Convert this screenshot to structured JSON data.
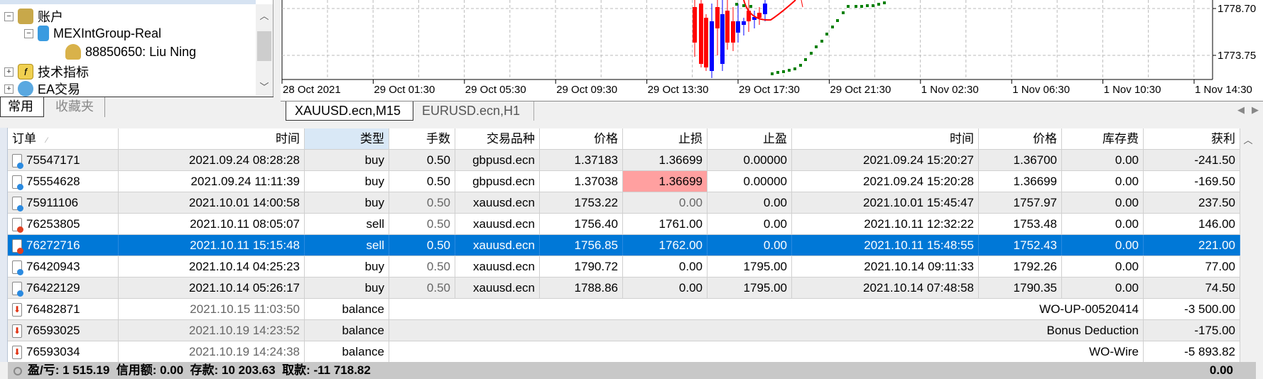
{
  "navigator": {
    "items": [
      {
        "label": "账户",
        "expander": "−",
        "icon": "accounts-icon"
      },
      {
        "label": "MEXIntGroup-Real",
        "expander": "−",
        "icon": "server-icon"
      },
      {
        "label": "88850650: Liu Ning",
        "icon": "user-icon"
      },
      {
        "label": "技术指标",
        "expander": "+",
        "icon": "indicator-icon"
      },
      {
        "label": "EA交易",
        "expander": "+",
        "icon": "expert-advisor-icon"
      }
    ],
    "tabs": [
      "常用",
      "收藏夹"
    ]
  },
  "chart": {
    "price_labels": [
      "1778.70",
      "1773.75"
    ],
    "time_labels": [
      "28 Oct 2021",
      "29 Oct 01:30",
      "29 Oct 05:30",
      "29 Oct 09:30",
      "29 Oct 13:30",
      "29 Oct 17:30",
      "29 Oct 21:30",
      "1 Nov 02:30",
      "1 Nov 06:30",
      "1 Nov 10:30",
      "1 Nov 14:30"
    ],
    "tabs": [
      "XAUUSD.ecn,M15",
      "EURUSD.ecn,H1"
    ],
    "colors": {
      "bull": "#0000ff",
      "bear": "#ff0000",
      "ma": "#ff0000",
      "sar": "#008000"
    }
  },
  "table": {
    "headers": [
      "订单",
      "时间",
      "类型",
      "手数",
      "交易品种",
      "价格",
      "止损",
      "止盈",
      "时间",
      "价格",
      "库存费",
      "获利"
    ],
    "sort_indicator": "⁄",
    "rows": [
      {
        "kind": "buy",
        "cells": [
          "75547171",
          "2021.09.24 08:28:28",
          "buy",
          "0.50",
          "gbpusd.ecn",
          "1.37183",
          "1.36699",
          "0.00000",
          "2021.09.24 15:20:27",
          "1.36700",
          "0.00",
          "-241.50"
        ]
      },
      {
        "kind": "buy",
        "sl_hit": true,
        "cells": [
          "75554628",
          "2021.09.24 11:11:39",
          "buy",
          "0.50",
          "gbpusd.ecn",
          "1.37038",
          "1.36699",
          "0.00000",
          "2021.09.24 15:20:28",
          "1.36699",
          "0.00",
          "-169.50"
        ]
      },
      {
        "kind": "buy",
        "cells": [
          "75911106",
          "2021.10.01 14:00:58",
          "buy",
          "0.50",
          "xauusd.ecn",
          "1753.22",
          "0.00",
          "0.00",
          "2021.10.01 15:45:47",
          "1757.97",
          "0.00",
          "237.50"
        ]
      },
      {
        "kind": "sell",
        "cells": [
          "76253805",
          "2021.10.11 08:05:07",
          "sell",
          "0.50",
          "xauusd.ecn",
          "1756.40",
          "1761.00",
          "0.00",
          "2021.10.11 12:32:22",
          "1753.48",
          "0.00",
          "146.00"
        ]
      },
      {
        "kind": "sell",
        "selected": true,
        "cells": [
          "76272716",
          "2021.10.11 15:15:48",
          "sell",
          "0.50",
          "xauusd.ecn",
          "1756.85",
          "1762.00",
          "0.00",
          "2021.10.11 15:48:55",
          "1752.43",
          "0.00",
          "221.00"
        ]
      },
      {
        "kind": "buy",
        "cells": [
          "76420943",
          "2021.10.14 04:25:23",
          "buy",
          "0.50",
          "xauusd.ecn",
          "1790.72",
          "0.00",
          "1795.00",
          "2021.10.14 09:11:33",
          "1792.26",
          "0.00",
          "77.00"
        ]
      },
      {
        "kind": "buy",
        "cells": [
          "76422129",
          "2021.10.14 05:26:17",
          "buy",
          "0.50",
          "xauusd.ecn",
          "1788.86",
          "0.00",
          "1795.00",
          "2021.10.14 07:48:58",
          "1790.35",
          "0.00",
          "74.50"
        ]
      },
      {
        "kind": "balance",
        "cells": [
          "76482871",
          "2021.10.15 11:03:50",
          "balance",
          "WO-UP-00520414",
          "-3 500.00"
        ]
      },
      {
        "kind": "balance",
        "cells": [
          "76593025",
          "2021.10.19 14:23:52",
          "balance",
          "Bonus Deduction",
          "-175.00"
        ]
      },
      {
        "kind": "balance",
        "cells": [
          "76593034",
          "2021.10.19 14:24:38",
          "balance",
          "WO-Wire",
          "-5 893.82"
        ]
      }
    ],
    "footer": {
      "summary": "盈/亏: 1 515.19  信用额: 0.00  存款: 10 203.63  取款: -11 718.82",
      "total": "0.00"
    },
    "colors": {
      "selected": "#0078d7",
      "sl_highlight": "#ffa0a0"
    }
  }
}
